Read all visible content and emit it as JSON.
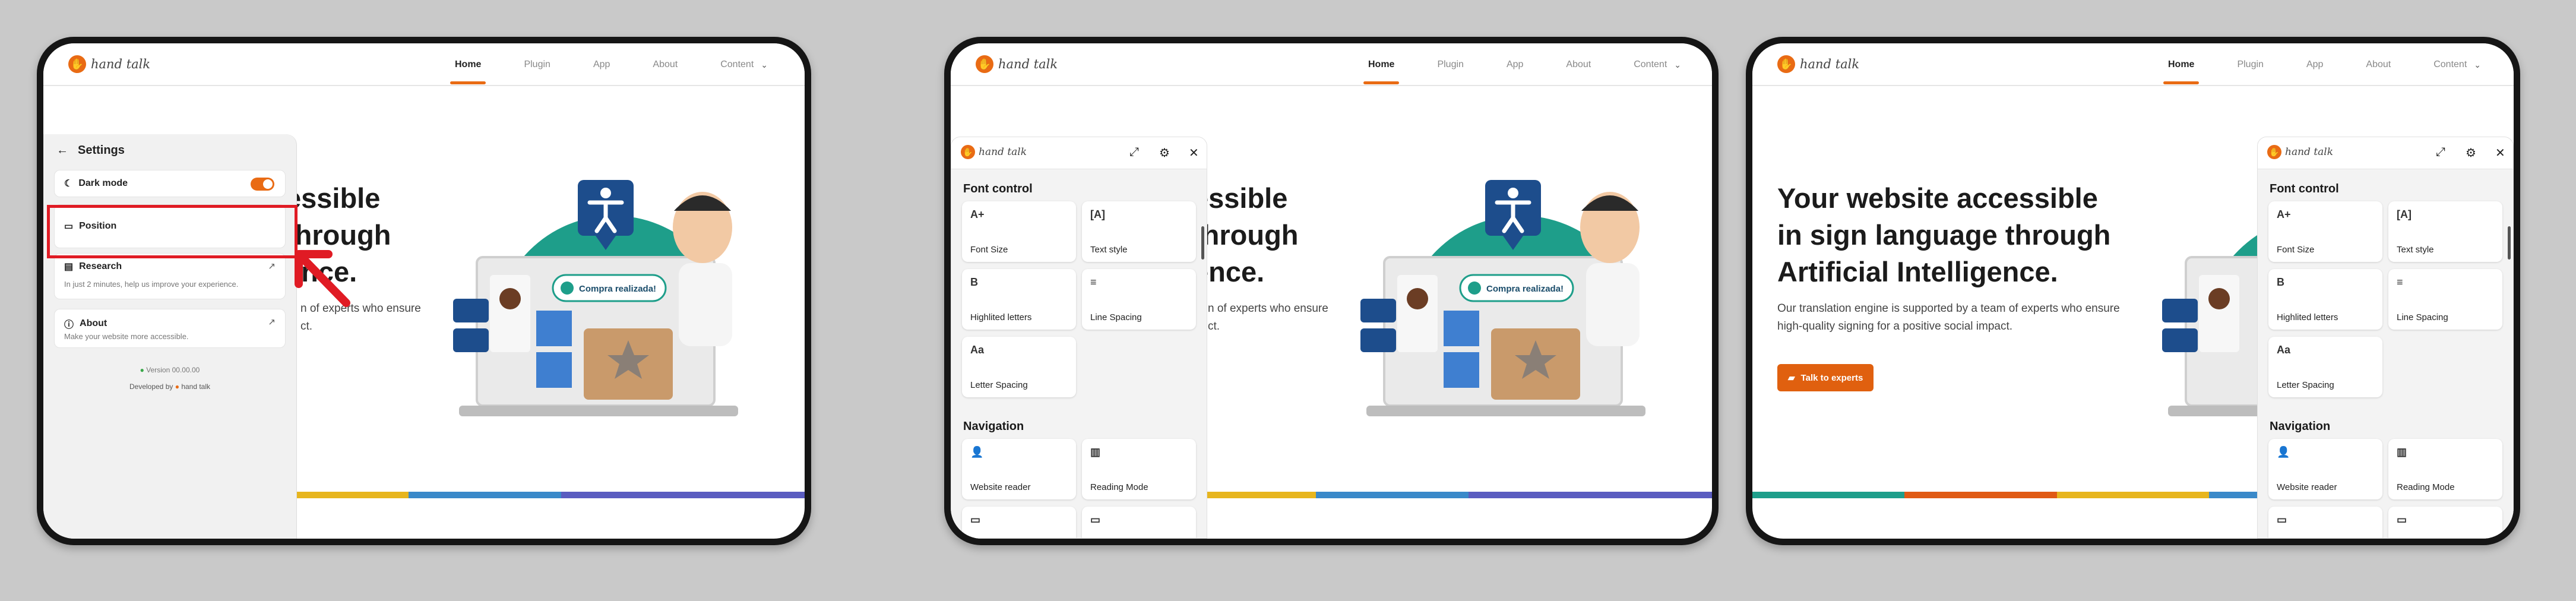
{
  "brand": {
    "logo_text": "hand talk"
  },
  "nav": {
    "items": [
      "Home",
      "Plugin",
      "App",
      "About",
      "Content"
    ],
    "active": "Home"
  },
  "hero": {
    "title_lines": [
      "Your website accessible",
      "in sign language through",
      "Artificial Intelligence."
    ],
    "desc_lines": [
      "Our translation engine is supported by a team of experts who ensure",
      "high-quality signing for a positive social impact."
    ],
    "partial_title_lines": [
      "essible",
      "through",
      "ence."
    ],
    "partial_desc_lines": [
      "n of experts who ensure",
      "ct."
    ],
    "cta_label": "Talk to experts",
    "speech_bubble": "Compra realizada!"
  },
  "settings": {
    "title": "Settings",
    "dark_mode_label": "Dark mode",
    "dark_mode_on": true,
    "position_label": "Position",
    "research_label": "Research",
    "research_desc": "In just 2 minutes, help us improve your experience.",
    "about_label": "About",
    "about_desc": "Make your website more accessible.",
    "version": "Version 00.00.00",
    "developed_by": "Developed by"
  },
  "widget": {
    "font_section": "Font control",
    "font_tiles": [
      {
        "icon": "A+",
        "label": "Font Size"
      },
      {
        "icon": "[A]",
        "label": "Text style"
      },
      {
        "icon": "B",
        "label": "Highlited letters"
      },
      {
        "icon": "≡",
        "label": "Line Spacing"
      },
      {
        "icon": "Aa",
        "label": "Letter Spacing"
      }
    ],
    "nav_section": "Navigation",
    "nav_tiles": [
      {
        "icon": "speaker-person-icon",
        "label": "Website reader"
      },
      {
        "icon": "book-icon",
        "label": "Reading Mode"
      }
    ]
  },
  "colors": {
    "accent": "#e96b14",
    "highlight": "#e01b24",
    "teal": "#1e9e8a",
    "navy": "#1d4d8c"
  }
}
